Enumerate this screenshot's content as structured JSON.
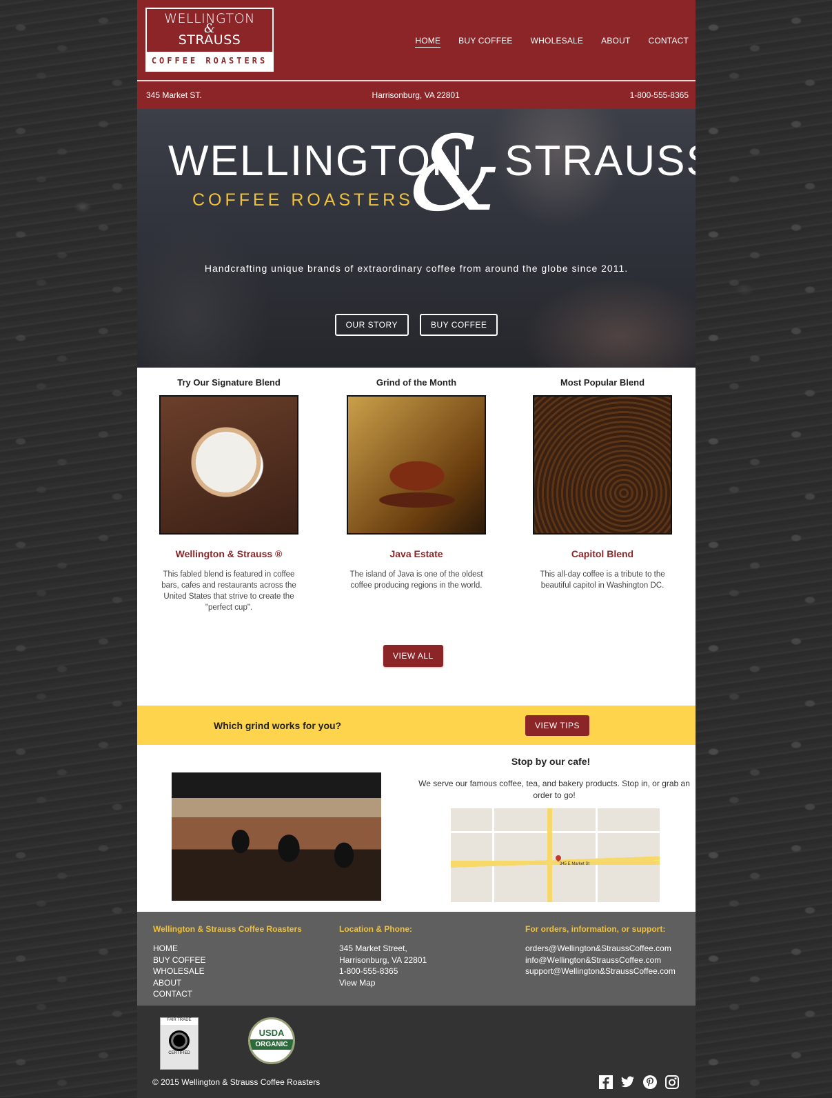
{
  "header": {
    "logo": {
      "line1": "WELLINGTON",
      "amp": "&",
      "line2": "STRAUSS",
      "sub": "COFFEE ROASTERS"
    },
    "nav": [
      "HOME",
      "BUY COFFEE",
      "WHOLESALE",
      "ABOUT",
      "CONTACT"
    ],
    "address": "345 Market ST.",
    "city": "Harrisonburg, VA 22801",
    "phone": "1-800-555-8365"
  },
  "hero": {
    "brand_left": "WELLINGTON",
    "brand_amp": "&",
    "brand_right": "STRAUSS",
    "sub": "COFFEE ROASTERS",
    "tagline": "Handcrafting unique brands of extraordinary coffee from around the globe since 2011.",
    "buttons": [
      "OUR STORY",
      "BUY COFFEE"
    ]
  },
  "products": [
    {
      "heading": "Try Our Signature Blend",
      "name": "Wellington & Strauss ®",
      "desc": "This fabled blend is featured in coffee bars, cafes and restaurants across the United States that strive to create the \"perfect cup\"."
    },
    {
      "heading": "Grind of the Month",
      "name": "Java Estate",
      "desc": "The island of Java is one of the oldest coffee producing regions in the world."
    },
    {
      "heading": "Most Popular Blend",
      "name": "Capitol Blend",
      "desc": "This all-day coffee is a tribute to the beautiful capitol in Washington DC."
    }
  ],
  "view_all": "VIEW ALL",
  "grind": {
    "question": "Which grind works for you?",
    "button": "VIEW TIPS"
  },
  "cafe": {
    "title": "Stop by our cafe!",
    "text": "We serve our famous coffee, tea, and bakery products. Stop in, or grab an order to go!",
    "map_label": "345 E Market St"
  },
  "footer": {
    "col1": {
      "title": "Wellington & Strauss Coffee Roasters",
      "links": [
        "HOME",
        "BUY COFFEE",
        "WHOLESALE",
        "ABOUT",
        "CONTACT"
      ]
    },
    "col2": {
      "title": "Location & Phone:",
      "lines": [
        "345 Market Street,",
        "Harrisonburg, VA 22801",
        "1-800-555-8365",
        "View Map"
      ]
    },
    "col3": {
      "title": "For orders, information, or support:",
      "lines": [
        "orders@Wellington&StraussCoffee.com",
        "info@Wellington&StraussCoffee.com",
        "support@Wellington&StraussCoffee.com"
      ]
    }
  },
  "bottom": {
    "fair_trade_top": "FAIR TRADE",
    "fair_trade_bottom": "CERTIFIED",
    "usda_top": "USDA",
    "usda_band": "ORGANIC",
    "copyright": "© 2015 Wellington & Strauss Coffee Roasters",
    "social": [
      "facebook-icon",
      "twitter-icon",
      "pinterest-icon",
      "instagram-icon"
    ]
  },
  "colors": {
    "brand_red": "#8c2528",
    "accent_yellow": "#fed44c",
    "gold": "#f0c13a"
  }
}
